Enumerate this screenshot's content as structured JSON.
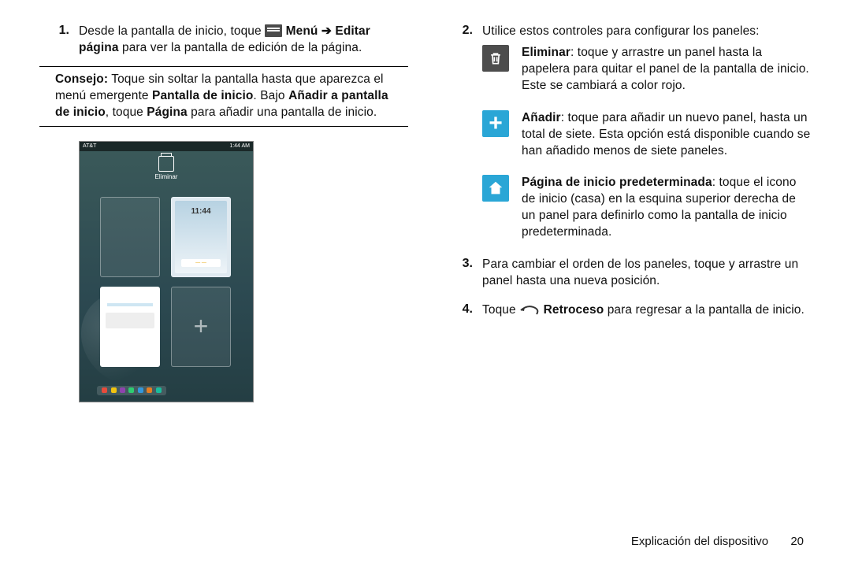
{
  "left": {
    "step1_num": "1.",
    "step1_a": "Desde la pantalla de inicio, toque ",
    "step1_menu": "Menú",
    "step1_arrow": " ➔ ",
    "step1_editar": "Editar página",
    "step1_b": " para ver la pantalla de edición de la página.",
    "consejo_label": "Consejo:",
    "consejo_a": " Toque sin soltar la pantalla hasta que aparezca el menú emergente ",
    "consejo_pantalla": "Pantalla de inicio",
    "consejo_b": ". Bajo ",
    "consejo_anadir": "Añadir a pantalla de inicio",
    "consejo_c": ", toque ",
    "consejo_pagina": "Página",
    "consejo_d": " para añadir una pantalla de inicio.",
    "phone": {
      "status_left": "AT&T",
      "status_right": "1:44 AM",
      "trash_label": "Eliminar",
      "clock": "11:44"
    }
  },
  "right": {
    "step2_num": "2.",
    "step2_text": "Utilice estos controles para configurar los paneles:",
    "ctrl_trash_b": "Eliminar",
    "ctrl_trash_t": ": toque y arrastre un panel hasta la papelera para quitar el panel de la pantalla de inicio. Este se cambiará a color rojo.",
    "ctrl_add_b": "Añadir",
    "ctrl_add_t": ": toque para añadir un nuevo panel, hasta un total de siete. Esta opción está disponible cuando se han añadido menos de siete paneles.",
    "ctrl_home_b": "Página de inicio predeterminada",
    "ctrl_home_t": ": toque el icono de inicio (casa) en la esquina superior derecha de un panel para definirlo como la pantalla de inicio predeterminada.",
    "step3_num": "3.",
    "step3_text": "Para cambiar el orden de los paneles, toque y arrastre un panel hasta una nueva posición.",
    "step4_num": "4.",
    "step4_a": "Toque ",
    "step4_retro": "Retroceso",
    "step4_b": " para regresar a la pantalla de inicio."
  },
  "footer": {
    "section": "Explicación del dispositivo",
    "page": "20"
  }
}
